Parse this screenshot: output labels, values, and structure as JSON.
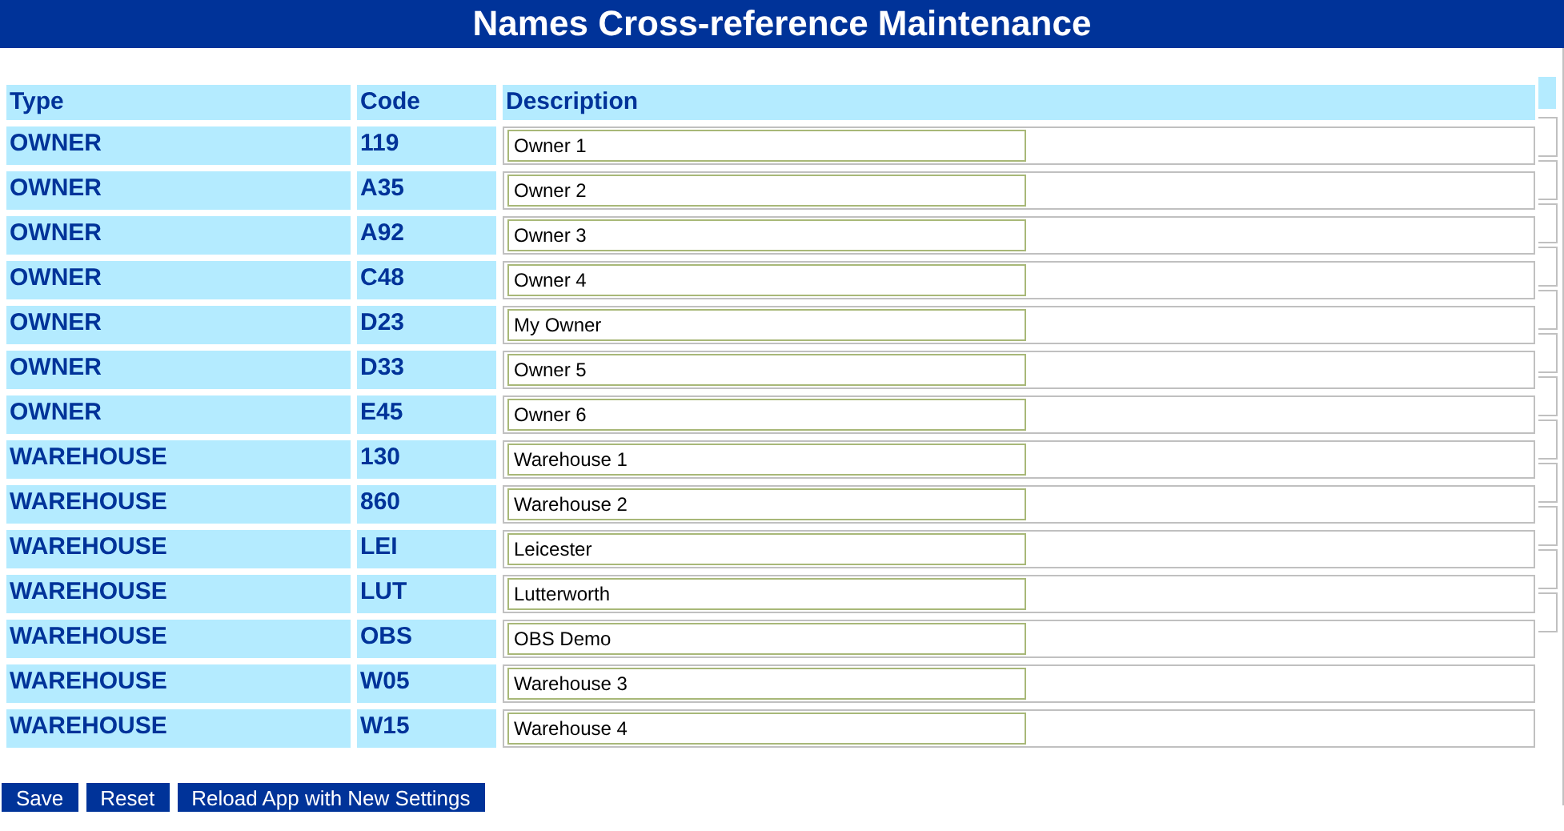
{
  "title": "Names Cross-reference Maintenance",
  "columns": [
    "Type",
    "Code",
    "Description"
  ],
  "rows": [
    {
      "type": "OWNER",
      "code": "119",
      "description": "Owner 1"
    },
    {
      "type": "OWNER",
      "code": "A35",
      "description": "Owner 2"
    },
    {
      "type": "OWNER",
      "code": "A92",
      "description": "Owner 3"
    },
    {
      "type": "OWNER",
      "code": "C48",
      "description": "Owner 4"
    },
    {
      "type": "OWNER",
      "code": "D23",
      "description": "My Owner"
    },
    {
      "type": "OWNER",
      "code": "D33",
      "description": "Owner 5"
    },
    {
      "type": "OWNER",
      "code": "E45",
      "description": "Owner 6"
    },
    {
      "type": "WAREHOUSE",
      "code": "130",
      "description": "Warehouse 1"
    },
    {
      "type": "WAREHOUSE",
      "code": "860",
      "description": "Warehouse 2"
    },
    {
      "type": "WAREHOUSE",
      "code": "LEI",
      "description": "Leicester"
    },
    {
      "type": "WAREHOUSE",
      "code": "LUT",
      "description": "Lutterworth"
    },
    {
      "type": "WAREHOUSE",
      "code": "OBS",
      "description": "OBS Demo"
    },
    {
      "type": "WAREHOUSE",
      "code": "W05",
      "description": "Warehouse 3"
    },
    {
      "type": "WAREHOUSE",
      "code": "W15",
      "description": "Warehouse 4"
    }
  ],
  "buttons": [
    "Save",
    "Reset",
    "Reload App with New Settings"
  ]
}
